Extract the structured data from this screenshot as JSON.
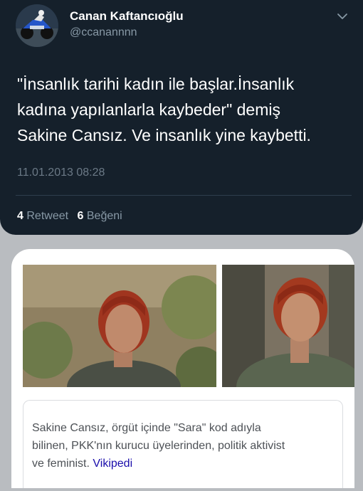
{
  "tweet": {
    "display_name": "Canan Kaftancıoğlu",
    "handle": "@ccanannnn",
    "text_lines": [
      "\"İnsanlık tarihi kadın ile başlar.İnsanlık",
      "kadına yapılanlarla kaybeder\" demiş",
      "Sakine Cansız. Ve insanlık yine kaybetti."
    ],
    "timestamp": "11.01.2013 08:28",
    "retweet_count": "4",
    "retweet_label": "Retweet",
    "like_count": "6",
    "like_label": "Beğeni",
    "menu_icon": "chevron-down-icon"
  },
  "result_card": {
    "description_lines": [
      "Sakine Cansız, örgüt içinde \"Sara\" kod adıyla",
      "bilinen, PKK'nın kurucu üyelerinden, politik aktivist",
      "ve feminist."
    ],
    "source_link": "Vikipedi"
  },
  "colors": {
    "tweet_background": "#15202b",
    "secondary_text": "#8899a6",
    "link": "#1a0dab"
  }
}
